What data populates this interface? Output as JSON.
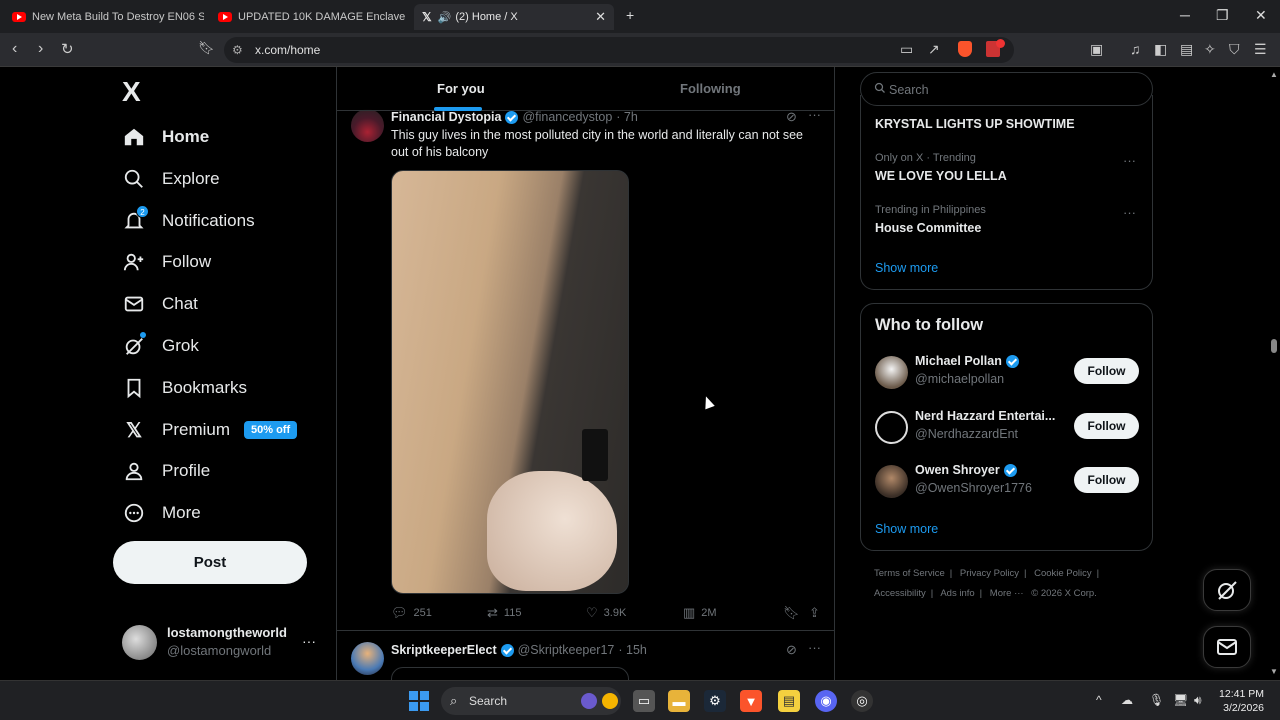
{
  "browser": {
    "tabs": [
      {
        "label": "New Meta Build To Destroy EN06 Sh"
      },
      {
        "label": "UPDATED 10K DAMAGE Enclave Plas"
      },
      {
        "label": "(2) Home / X"
      }
    ],
    "url": "x.com/home"
  },
  "sidebar": {
    "logo": "X",
    "items": [
      {
        "label": "Home",
        "icon": "home-icon"
      },
      {
        "label": "Explore",
        "icon": "search-icon"
      },
      {
        "label": "Notifications",
        "icon": "bell-icon",
        "badge": "2"
      },
      {
        "label": "Follow",
        "icon": "person-plus-icon"
      },
      {
        "label": "Chat",
        "icon": "mail-icon"
      },
      {
        "label": "Grok",
        "icon": "grok-icon"
      },
      {
        "label": "Bookmarks",
        "icon": "bookmark-icon"
      },
      {
        "label": "Premium",
        "icon": "x-icon",
        "badge": "50% off"
      },
      {
        "label": "Profile",
        "icon": "person-icon"
      },
      {
        "label": "More",
        "icon": "more-circle-icon"
      }
    ],
    "post_button": "Post",
    "account": {
      "name": "lostamongtheworld",
      "handle": "@lostamongworld"
    }
  },
  "feed": {
    "tabs": {
      "for_you": "For you",
      "following": "Following"
    },
    "tweets": [
      {
        "name": "Financial Dystopia",
        "handle": "@financedystop",
        "time": "· 7h",
        "text": "This guy lives in the most polluted city in the world and literally can not see out of his balcony",
        "replies": "251",
        "reposts": "115",
        "likes": "3.9K",
        "views": "2M"
      },
      {
        "name": "SkriptkeeperElect",
        "handle": "@Skriptkeeper17",
        "time": "· 15h"
      }
    ]
  },
  "right": {
    "search_placeholder": "Search",
    "trends": [
      {
        "context": "",
        "title": "KRYSTAL LIGHTS UP SHOWTIME"
      },
      {
        "context": "Only on X · Trending",
        "title": "WE LOVE YOU LELLA"
      },
      {
        "context": "Trending in Philippines",
        "title": "House Committee"
      }
    ],
    "trends_show_more": "Show more",
    "who_to_follow": {
      "title": "Who to follow",
      "accounts": [
        {
          "name": "Michael Pollan",
          "handle": "@michaelpollan",
          "verified": true
        },
        {
          "name": "Nerd Hazzard Entertai...",
          "handle": "@NerdhazzardEnt",
          "verified": false
        },
        {
          "name": "Owen Shroyer",
          "handle": "@OwenShroyer1776",
          "verified": true
        }
      ],
      "follow_label": "Follow",
      "show_more": "Show more"
    },
    "footer": {
      "links": [
        "Terms of Service",
        "Privacy Policy",
        "Cookie Policy",
        "Accessibility",
        "Ads info",
        "More ···"
      ],
      "copyright": "© 2026 X Corp."
    }
  },
  "taskbar": {
    "search": "Search",
    "time": "12:41 PM",
    "date": "3/2/2026"
  },
  "colors": {
    "accent": "#1d9bf0",
    "background": "#000000",
    "text": "#e7e9ea",
    "muted": "#71767b"
  }
}
